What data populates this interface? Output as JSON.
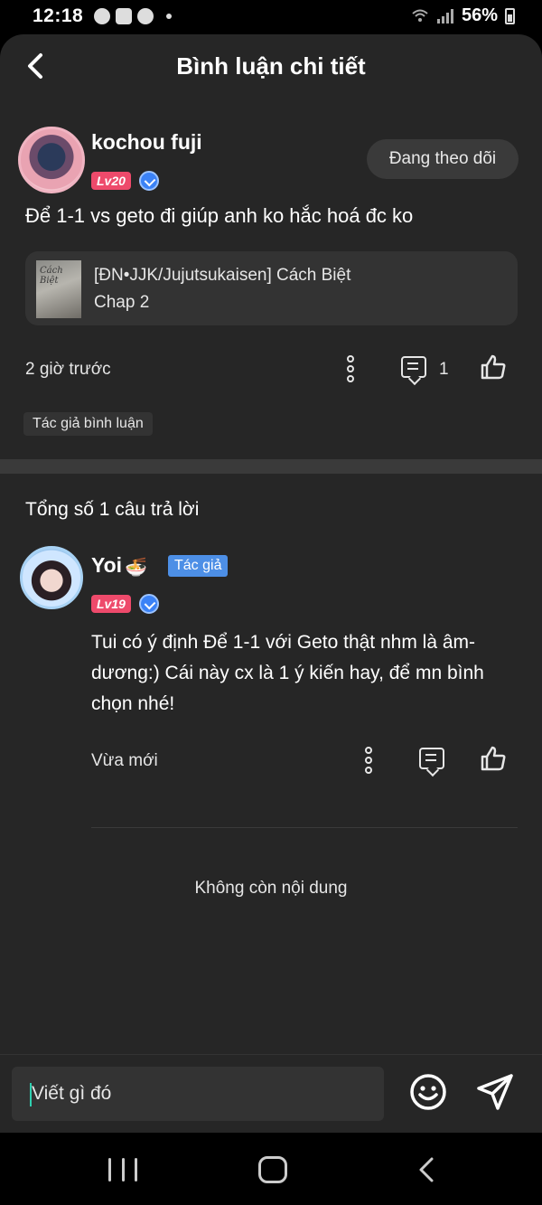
{
  "status_bar": {
    "time": "12:18",
    "battery": "56%"
  },
  "header": {
    "title": "Bình luận chi tiết"
  },
  "comment": {
    "username": "kochou fuji",
    "level": "Lv20",
    "follow_label": "Đang theo dõi",
    "text": "Để 1-1 vs geto đi giúp anh ko hắc hoá đc ko",
    "story": {
      "title": "[ĐN•JJK/Jujutsukaisen] Cách Biệt",
      "chapter": "Chap 2",
      "cover_text": "Cách Biệt"
    },
    "time": "2 giờ trước",
    "reply_count": "1",
    "tag": "Tác giả bình luận"
  },
  "replies_section": {
    "total_label": "Tổng số 1 câu trả lời"
  },
  "reply": {
    "username": "Yoi",
    "emoji": "🍜",
    "level": "Lv19",
    "author_badge": "Tác giả",
    "text": "Tui có ý định Để 1-1 với Geto thật nhm là âm-dương:) Cái này cx là 1 ý kiến hay, để mn bình chọn nhé!",
    "time": "Vừa mới"
  },
  "end_of_content": "Không còn nội dung",
  "composer": {
    "placeholder": "Viết gì đó"
  },
  "icons": {
    "back": "back-arrow-icon",
    "more": "more-vertical-icon",
    "comment": "comment-icon",
    "like": "thumbs-up-icon",
    "emoji": "smiley-icon",
    "send": "send-icon",
    "verified": "verified-badge-icon"
  },
  "colors": {
    "background": "#262626",
    "level_badge": "#ee4a6b",
    "author_badge": "#4d8fe6",
    "verified": "#3b82f6"
  }
}
